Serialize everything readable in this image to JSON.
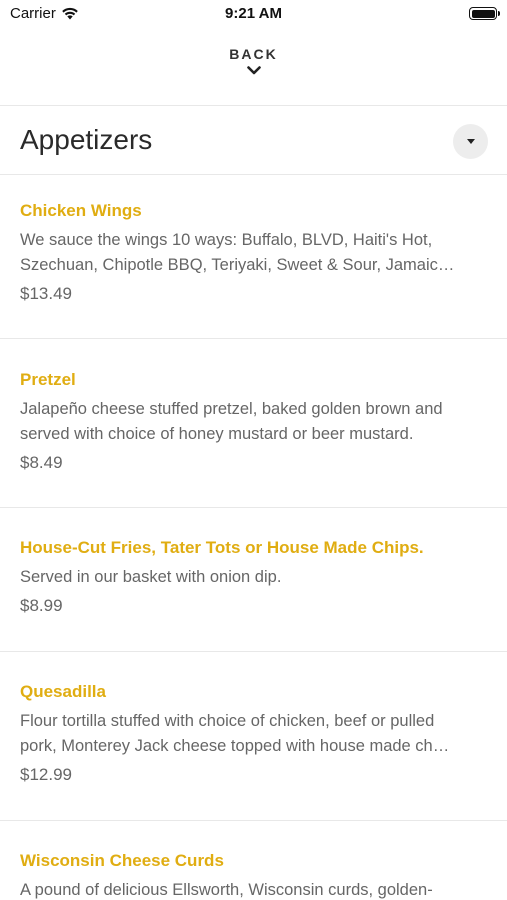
{
  "status": {
    "carrier": "Carrier",
    "time": "9:21 AM"
  },
  "nav": {
    "back_label": "BACK"
  },
  "section": {
    "title": "Appetizers"
  },
  "items": [
    {
      "name": "Chicken Wings",
      "desc_lines": [
        "We sauce the wings 10 ways: Buffalo, BLVD, Haiti's Hot,",
        "Szechuan, Chipotle BBQ, Teriyaki, Sweet & Sour, Jamaic…"
      ],
      "price": "$13.49"
    },
    {
      "name": "Pretzel",
      "desc_lines": [
        "Jalapeño cheese stuffed pretzel, baked golden brown and",
        "served with choice of honey mustard or beer mustard."
      ],
      "price": "$8.49"
    },
    {
      "name": "House-Cut Fries, Tater Tots or House Made Chips.",
      "desc_lines": [
        "Served in our basket with onion dip."
      ],
      "price": "$8.99"
    },
    {
      "name": "Quesadilla",
      "desc_lines": [
        "Flour tortilla stuffed with choice of chicken, beef or pulled",
        "pork, Monterey Jack cheese topped with house made ch…"
      ],
      "price": "$12.99"
    },
    {
      "name": "Wisconsin Cheese Curds",
      "desc_lines": [
        "A pound of delicious Ellsworth, Wisconsin curds, golden-"
      ],
      "price": ""
    }
  ],
  "colors": {
    "accent": "#e0ad12",
    "text": "#666666",
    "divider": "#e8e8e8"
  }
}
